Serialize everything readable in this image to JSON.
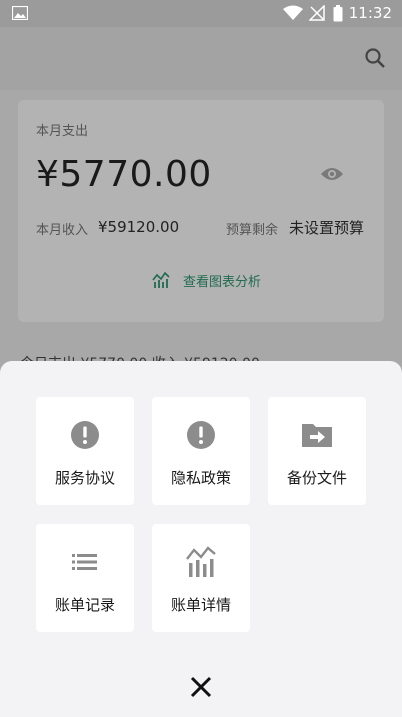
{
  "status_bar": {
    "time": "11:32"
  },
  "header": {
    "search_icon": "search-icon"
  },
  "summary": {
    "month_expense_label": "本月支出",
    "month_expense_amount": "¥5770.00",
    "month_income_label": "本月收入",
    "month_income_value": "¥59120.00",
    "budget_remaining_label": "预算剩余",
    "budget_remaining_value": "未设置预算",
    "chart_link_label": "查看图表分析"
  },
  "peek_text": "今日支出 ¥5770.00  收入 ¥59120.00",
  "sheet": {
    "tiles": [
      {
        "label": "服务协议",
        "icon": "alert-circle-icon"
      },
      {
        "label": "隐私政策",
        "icon": "alert-circle-icon"
      },
      {
        "label": "备份文件",
        "icon": "folder-export-icon"
      },
      {
        "label": "账单记录",
        "icon": "list-icon"
      },
      {
        "label": "账单详情",
        "icon": "chart-icon"
      }
    ],
    "close_icon": "close-icon"
  },
  "colors": {
    "accent_green": "#1f6b4f",
    "sheet_bg": "#f3f3f6",
    "icon_gray": "#8c8c8c"
  }
}
